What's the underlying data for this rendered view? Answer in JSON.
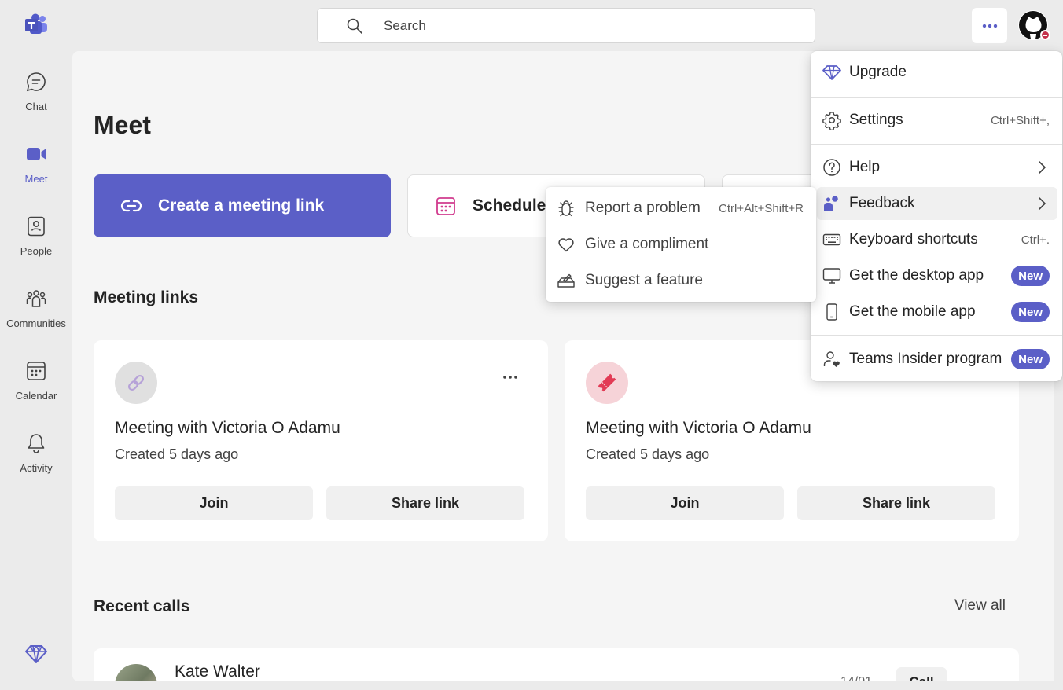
{
  "app": {
    "name": "Microsoft Teams",
    "accent": "#5b5fc7"
  },
  "search": {
    "placeholder": "Search"
  },
  "rail": {
    "items": [
      {
        "label": "Chat",
        "icon": "chat-icon"
      },
      {
        "label": "Meet",
        "icon": "video-camera-icon",
        "active": true
      },
      {
        "label": "People",
        "icon": "contacts-book-icon"
      },
      {
        "label": "Communities",
        "icon": "communities-icon"
      },
      {
        "label": "Calendar",
        "icon": "calendar-icon"
      },
      {
        "label": "Activity",
        "icon": "bell-icon"
      }
    ]
  },
  "meet": {
    "title": "Meet",
    "create_label": "Create a meeting link",
    "schedule_label": "Schedule",
    "meeting_links_heading": "Meeting links",
    "recent_calls_heading": "Recent calls",
    "view_all": "View all"
  },
  "cards": [
    {
      "title": "Meeting with Victoria O Adamu",
      "subtitle": "Created 5 days ago",
      "join": "Join",
      "share": "Share link",
      "thumb_icon": "link-icon"
    },
    {
      "title": "Meeting with Victoria O Adamu",
      "subtitle": "Created 5 days ago",
      "join": "Join",
      "share": "Share link",
      "thumb_icon": "ticket-icon"
    }
  ],
  "recent": [
    {
      "name": "Kate Walter",
      "date": "14/01",
      "call": "Call"
    }
  ],
  "menu": {
    "upgrade": "Upgrade",
    "settings": "Settings",
    "settings_shortcut": "Ctrl+Shift+,",
    "help": "Help",
    "feedback": "Feedback",
    "keyboard_shortcuts": "Keyboard shortcuts",
    "keyboard_shortcut": "Ctrl+.",
    "desktop_app": "Get the desktop app",
    "mobile_app": "Get the mobile app",
    "insider": "Teams Insider program",
    "new_badge": "New"
  },
  "submenu": {
    "report": "Report a problem",
    "report_shortcut": "Ctrl+Alt+Shift+R",
    "compliment": "Give a compliment",
    "suggest": "Suggest a feature"
  }
}
